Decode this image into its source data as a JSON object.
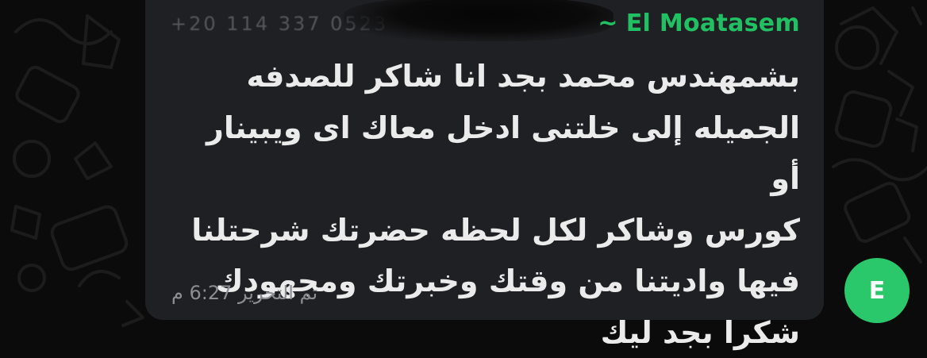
{
  "message": {
    "sender_prefix": "~",
    "sender_name": "El Moatasem",
    "sender_phone": "+20 114 337 0523",
    "text": "بشمهندس محمد بجد انا شاكر للصدفه\nالجميله إلى خلتنى ادخل معاك اى ويبينار أو\nكورس وشاكر لكل لحظه حضرتك شرحتلنا\nفيها واديتنا من وقتك وخبرتك ومجهودك\nشكرا بجد ليك",
    "edited_label": "تم التحرير",
    "time": "6:27 م"
  },
  "avatar": {
    "letter": "E",
    "color": "#2bc86b"
  },
  "colors": {
    "background": "#0b0b0b",
    "bubble": "#1f2023",
    "sender_name": "#21c063",
    "message_text": "#ebebeb",
    "meta_text": "#8a8d91"
  }
}
